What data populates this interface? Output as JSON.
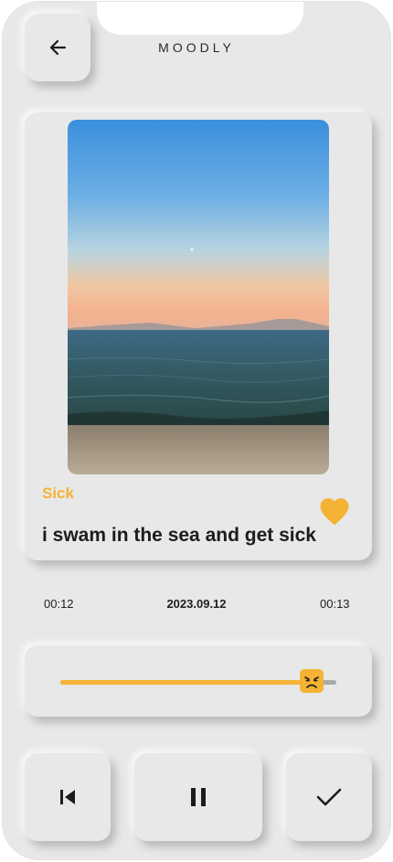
{
  "app": {
    "title": "MOODLY"
  },
  "post": {
    "mood": "Sick",
    "title": "i swam in the sea and get sick",
    "date": "2023.09.12",
    "liked": true
  },
  "player": {
    "current_time": "00:12",
    "total_time": "00:13",
    "progress": 0.91
  },
  "icons": {
    "back": "arrow-left-icon",
    "like": "heart-icon",
    "mood_thumb": "sick-face-icon",
    "previous": "skip-previous-icon",
    "pause": "pause-icon",
    "done": "checkmark-icon"
  },
  "colors": {
    "accent": "#f5b335",
    "background": "#e8e8e8",
    "text": "#1c1c1c",
    "track": "#a9a9a9"
  }
}
